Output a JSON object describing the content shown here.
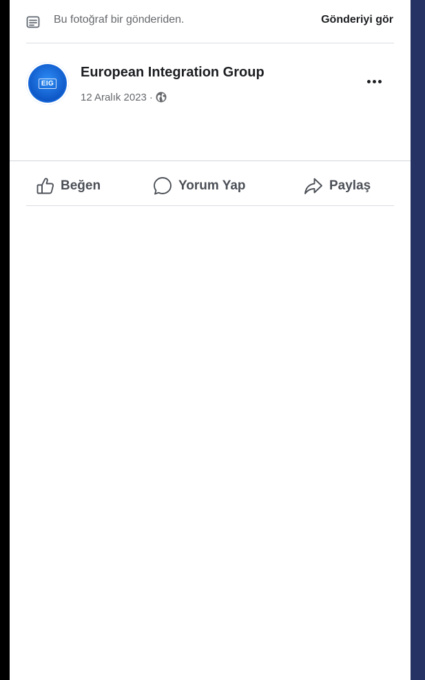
{
  "notice": {
    "icon": "document-icon",
    "text": "Bu fotoğraf bir gönderiden.",
    "link_label": "Gönderiyi gör"
  },
  "post": {
    "author": "European Integration Group",
    "avatar_text": "EIG",
    "date": "12 Aralık 2023",
    "separator": "·",
    "audience_icon": "globe-icon",
    "more_icon": "more-options-icon"
  },
  "actions": [
    {
      "label": "Beğen",
      "icon": "thumbs-up-icon"
    },
    {
      "label": "Yorum Yap",
      "icon": "comment-icon"
    },
    {
      "label": "Paylaş",
      "icon": "share-icon"
    }
  ],
  "colors": {
    "frame_left": "#000000",
    "frame_right": "#263264",
    "avatar_blue": "#1466d8",
    "text_primary": "#1c1e21",
    "text_secondary": "#65676b"
  }
}
